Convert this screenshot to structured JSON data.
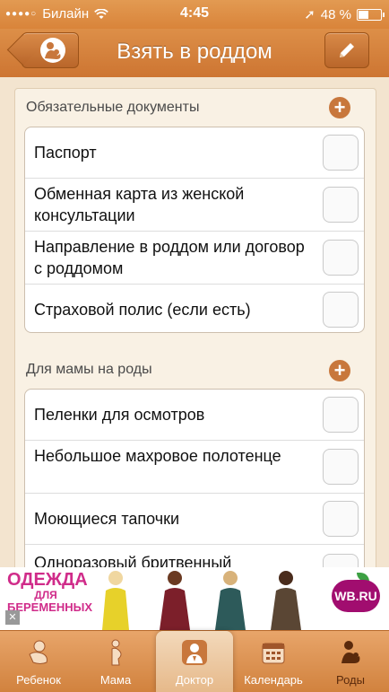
{
  "status_bar": {
    "carrier": "Билайн",
    "time": "4:45",
    "battery": "48 %",
    "battery_level": 0.48
  },
  "nav": {
    "title": "Взять в роддом"
  },
  "sections": [
    {
      "header": "Обязательные документы",
      "items": [
        {
          "label": "Паспорт",
          "checked": false
        },
        {
          "label": "Обменная карта из женской консультации",
          "checked": false
        },
        {
          "label": "Направление в роддом или договор с роддомом",
          "checked": false
        },
        {
          "label": "Страховой полис (если есть)",
          "checked": false
        }
      ]
    },
    {
      "header": "Для мамы на роды",
      "items": [
        {
          "label": "Пеленки для осмотров",
          "checked": false
        },
        {
          "label": "Небольшое махровое полотенце",
          "checked": false
        },
        {
          "label": "Моющиеся тапочки",
          "checked": false
        },
        {
          "label": "Одноразовый бритвенный",
          "checked": false
        }
      ]
    }
  ],
  "ad": {
    "line1": "ОДЕЖДА",
    "line2": "ДЛЯ",
    "line3": "БЕРЕМЕННЫХ",
    "brand": "WB.RU"
  },
  "tabs": [
    {
      "label": "Ребенок",
      "icon": "baby-icon"
    },
    {
      "label": "Мама",
      "icon": "mother-icon"
    },
    {
      "label": "Доктор",
      "icon": "doctor-icon"
    },
    {
      "label": "Календарь",
      "icon": "calendar-icon"
    },
    {
      "label": "Роды",
      "icon": "birth-icon"
    }
  ],
  "colors": {
    "accent": "#d9843a",
    "add_button": "#c8773c",
    "ad_pink": "#d02c8a"
  }
}
